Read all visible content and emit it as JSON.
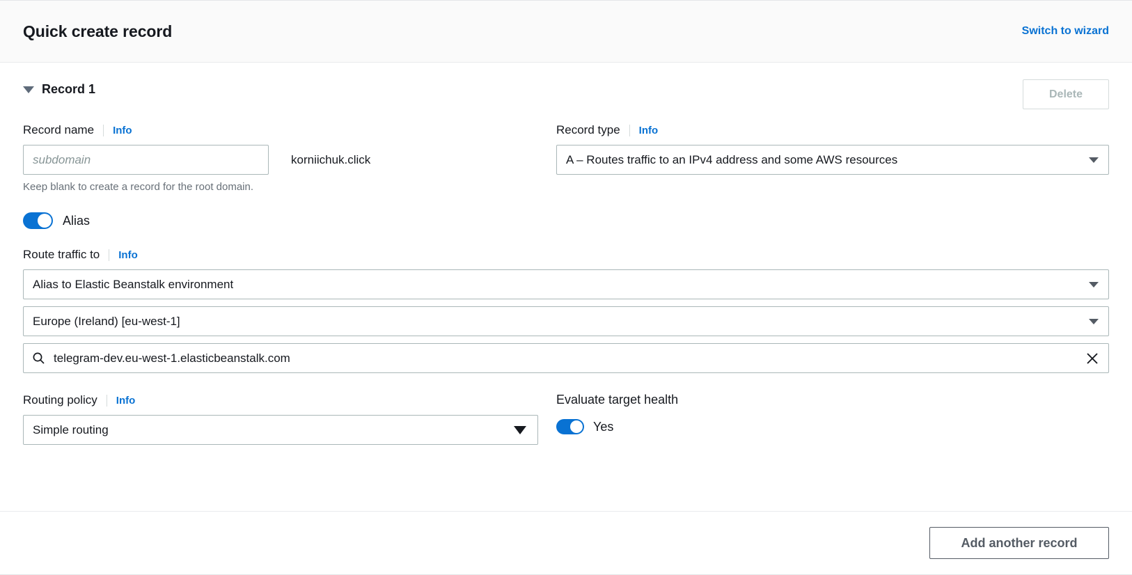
{
  "header": {
    "title": "Quick create record",
    "switch_label": "Switch to wizard"
  },
  "record": {
    "label": "Record 1",
    "delete_label": "Delete",
    "record_name": {
      "label": "Record name",
      "info_label": "Info",
      "value": "",
      "placeholder": "subdomain",
      "domain_suffix": "korniichuk.click",
      "help_text": "Keep blank to create a record for the root domain."
    },
    "record_type": {
      "label": "Record type",
      "info_label": "Info",
      "selected": "A – Routes traffic to an IPv4 address and some AWS resources"
    },
    "alias": {
      "label": "Alias",
      "enabled": true
    },
    "route_traffic_to": {
      "label": "Route traffic to",
      "info_label": "Info",
      "target_type": "Alias to Elastic Beanstalk environment",
      "region": "Europe (Ireland) [eu-west-1]",
      "endpoint_value": "telegram-dev.eu-west-1.elasticbeanstalk.com",
      "search_icon": "search-icon",
      "clear_icon": "close-icon"
    },
    "routing_policy": {
      "label": "Routing policy",
      "info_label": "Info",
      "selected": "Simple routing"
    },
    "evaluate_target_health": {
      "label": "Evaluate target health",
      "state_label": "Yes",
      "enabled": true
    }
  },
  "footer": {
    "add_another_label": "Add another record"
  },
  "colors": {
    "accent": "#0972d3",
    "text": "#16191f",
    "muted": "#687078",
    "disabled": "#aab7b8",
    "border": "#aab7b8",
    "header_bg": "#fafafa"
  }
}
